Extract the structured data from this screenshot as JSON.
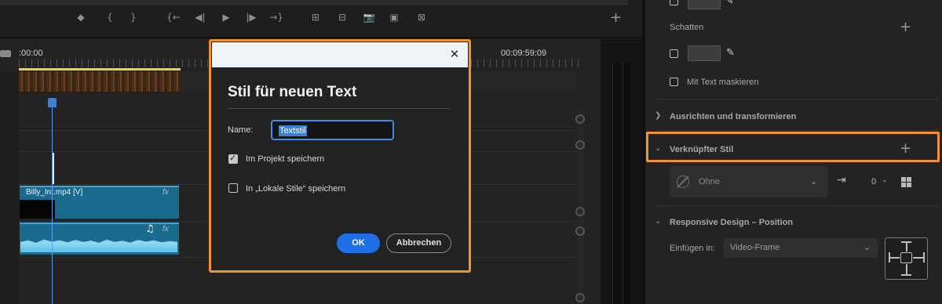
{
  "monitor": {
    "controls": [
      "◆",
      "{",
      "}",
      "{←",
      "◀|",
      "▶",
      "|▶",
      "→}",
      "⊞",
      "⊟",
      "📷",
      "▣",
      "⊠"
    ],
    "add_button": "+"
  },
  "timeline": {
    "time_start": ":00:00",
    "time_end": "00:09:59:09",
    "video_clip_label": "Billy_Int.mp4 [V]",
    "fx_label": "fx",
    "note_icon": "♫"
  },
  "panel": {
    "shadow_label": "Schatten",
    "mask_label": "Mit Text maskieren",
    "align_section": "Ausrichten und transformieren",
    "linked_style_section": "Verknüpfter Stil",
    "style_dropdown_value": "Ohne",
    "style_count": "0",
    "responsive_section": "Responsive Design – Position",
    "pin_label": "Einfügen in:",
    "pin_dropdown_value": "Video-Frame",
    "plus": "+"
  },
  "dialog": {
    "title": "Stil für neuen Text",
    "name_label": "Name:",
    "name_value": "Textstil",
    "save_project_label": "Im Projekt speichern",
    "save_project_checked": true,
    "save_local_label": "In „Lokale Stile“ speichern",
    "save_local_checked": false,
    "ok_label": "OK",
    "cancel_label": "Abbrechen",
    "close_glyph": "✕"
  },
  "colors": {
    "highlight": "#f0922e",
    "ok_button": "#1e6fe8",
    "clip": "#1a6a8e",
    "playhead": "#3b82d6",
    "work_area": "#e8d63a"
  }
}
